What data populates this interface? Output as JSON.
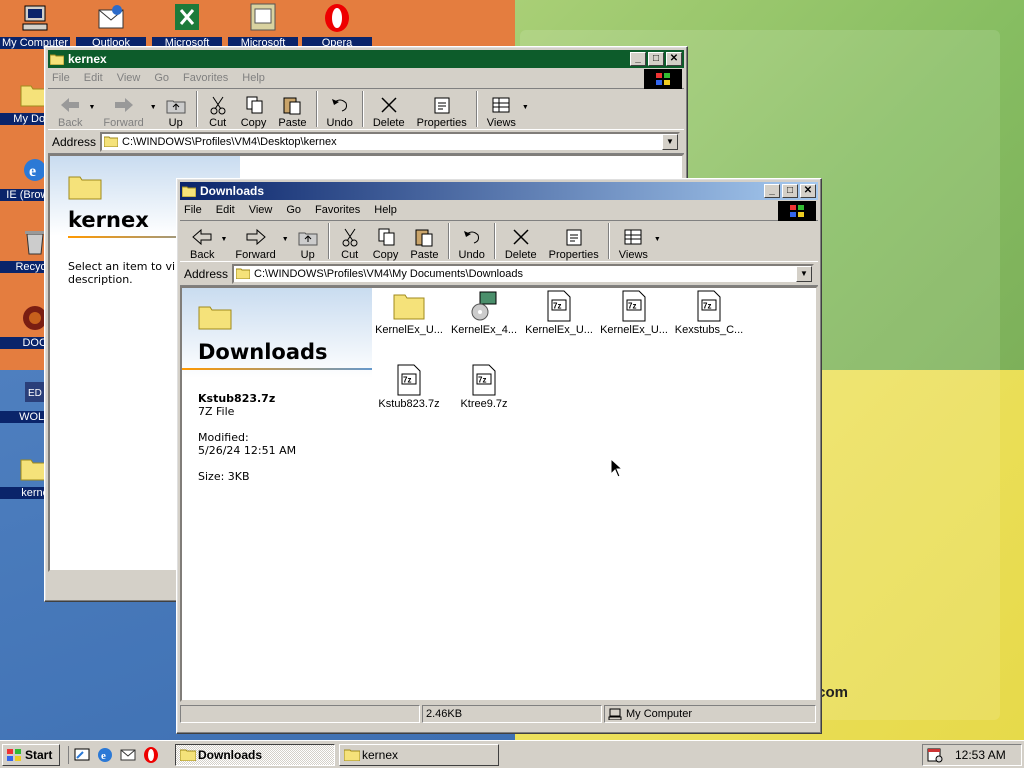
{
  "desktop": {
    "icons": [
      {
        "label": "My Computer",
        "icon": "my-computer-icon"
      },
      {
        "label": "Outlook",
        "icon": "outlook-icon"
      },
      {
        "label": "Microsoft",
        "icon": "excel-icon"
      },
      {
        "label": "Microsoft",
        "icon": "publisher-icon"
      },
      {
        "label": "Opera",
        "icon": "opera-icon"
      },
      {
        "label": "My Docu",
        "icon": "my-documents-icon"
      },
      {
        "label": "IE (Browser",
        "icon": "ie-icon"
      },
      {
        "label": "Recycle",
        "icon": "recycle-bin-icon"
      },
      {
        "label": "DOO",
        "icon": "doom-icon"
      },
      {
        "label": "WOLF",
        "icon": "wolf-icon"
      },
      {
        "label": "kerne",
        "icon": "folder-icon"
      }
    ],
    "wallpaper_text": "t.com"
  },
  "kernex_window": {
    "title": "kernex",
    "menu": [
      "File",
      "Edit",
      "View",
      "Go",
      "Favorites",
      "Help"
    ],
    "toolbar": [
      "Back",
      "Forward",
      "Up",
      "Cut",
      "Copy",
      "Paste",
      "Undo",
      "Delete",
      "Properties",
      "Views"
    ],
    "address_label": "Address",
    "address": "C:\\WINDOWS\\Profiles\\VM4\\Desktop\\kernex",
    "folder_title": "kernex",
    "hint": "Select an item to vi",
    "hint2": "description."
  },
  "downloads_window": {
    "title": "Downloads",
    "menu": [
      "File",
      "Edit",
      "View",
      "Go",
      "Favorites",
      "Help"
    ],
    "toolbar": [
      "Back",
      "Forward",
      "Up",
      "Cut",
      "Copy",
      "Paste",
      "Undo",
      "Delete",
      "Properties",
      "Views"
    ],
    "address_label": "Address",
    "address": "C:\\WINDOWS\\Profiles\\VM4\\My Documents\\Downloads",
    "folder_title": "Downloads",
    "selected_name": "Kstub823.7z",
    "selected_type": "7Z File",
    "modified_label": "Modified:",
    "modified_value": "5/26/24 12:51 AM",
    "size_text": "Size: 3KB",
    "files": [
      {
        "name": "KernelEx_U...",
        "type": "folder"
      },
      {
        "name": "KernelEx_4...",
        "type": "installer"
      },
      {
        "name": "KernelEx_U...",
        "type": "7z"
      },
      {
        "name": "KernelEx_U...",
        "type": "7z"
      },
      {
        "name": "Kexstubs_C...",
        "type": "7z"
      },
      {
        "name": "Kstub823.7z",
        "type": "7z"
      },
      {
        "name": "Ktree9.7z",
        "type": "7z"
      }
    ],
    "status_size": "2.46KB",
    "status_zone": "My Computer"
  },
  "taskbar": {
    "start_label": "Start",
    "tasks": [
      "Downloads",
      "kernex"
    ],
    "clock": "12:53 AM"
  }
}
